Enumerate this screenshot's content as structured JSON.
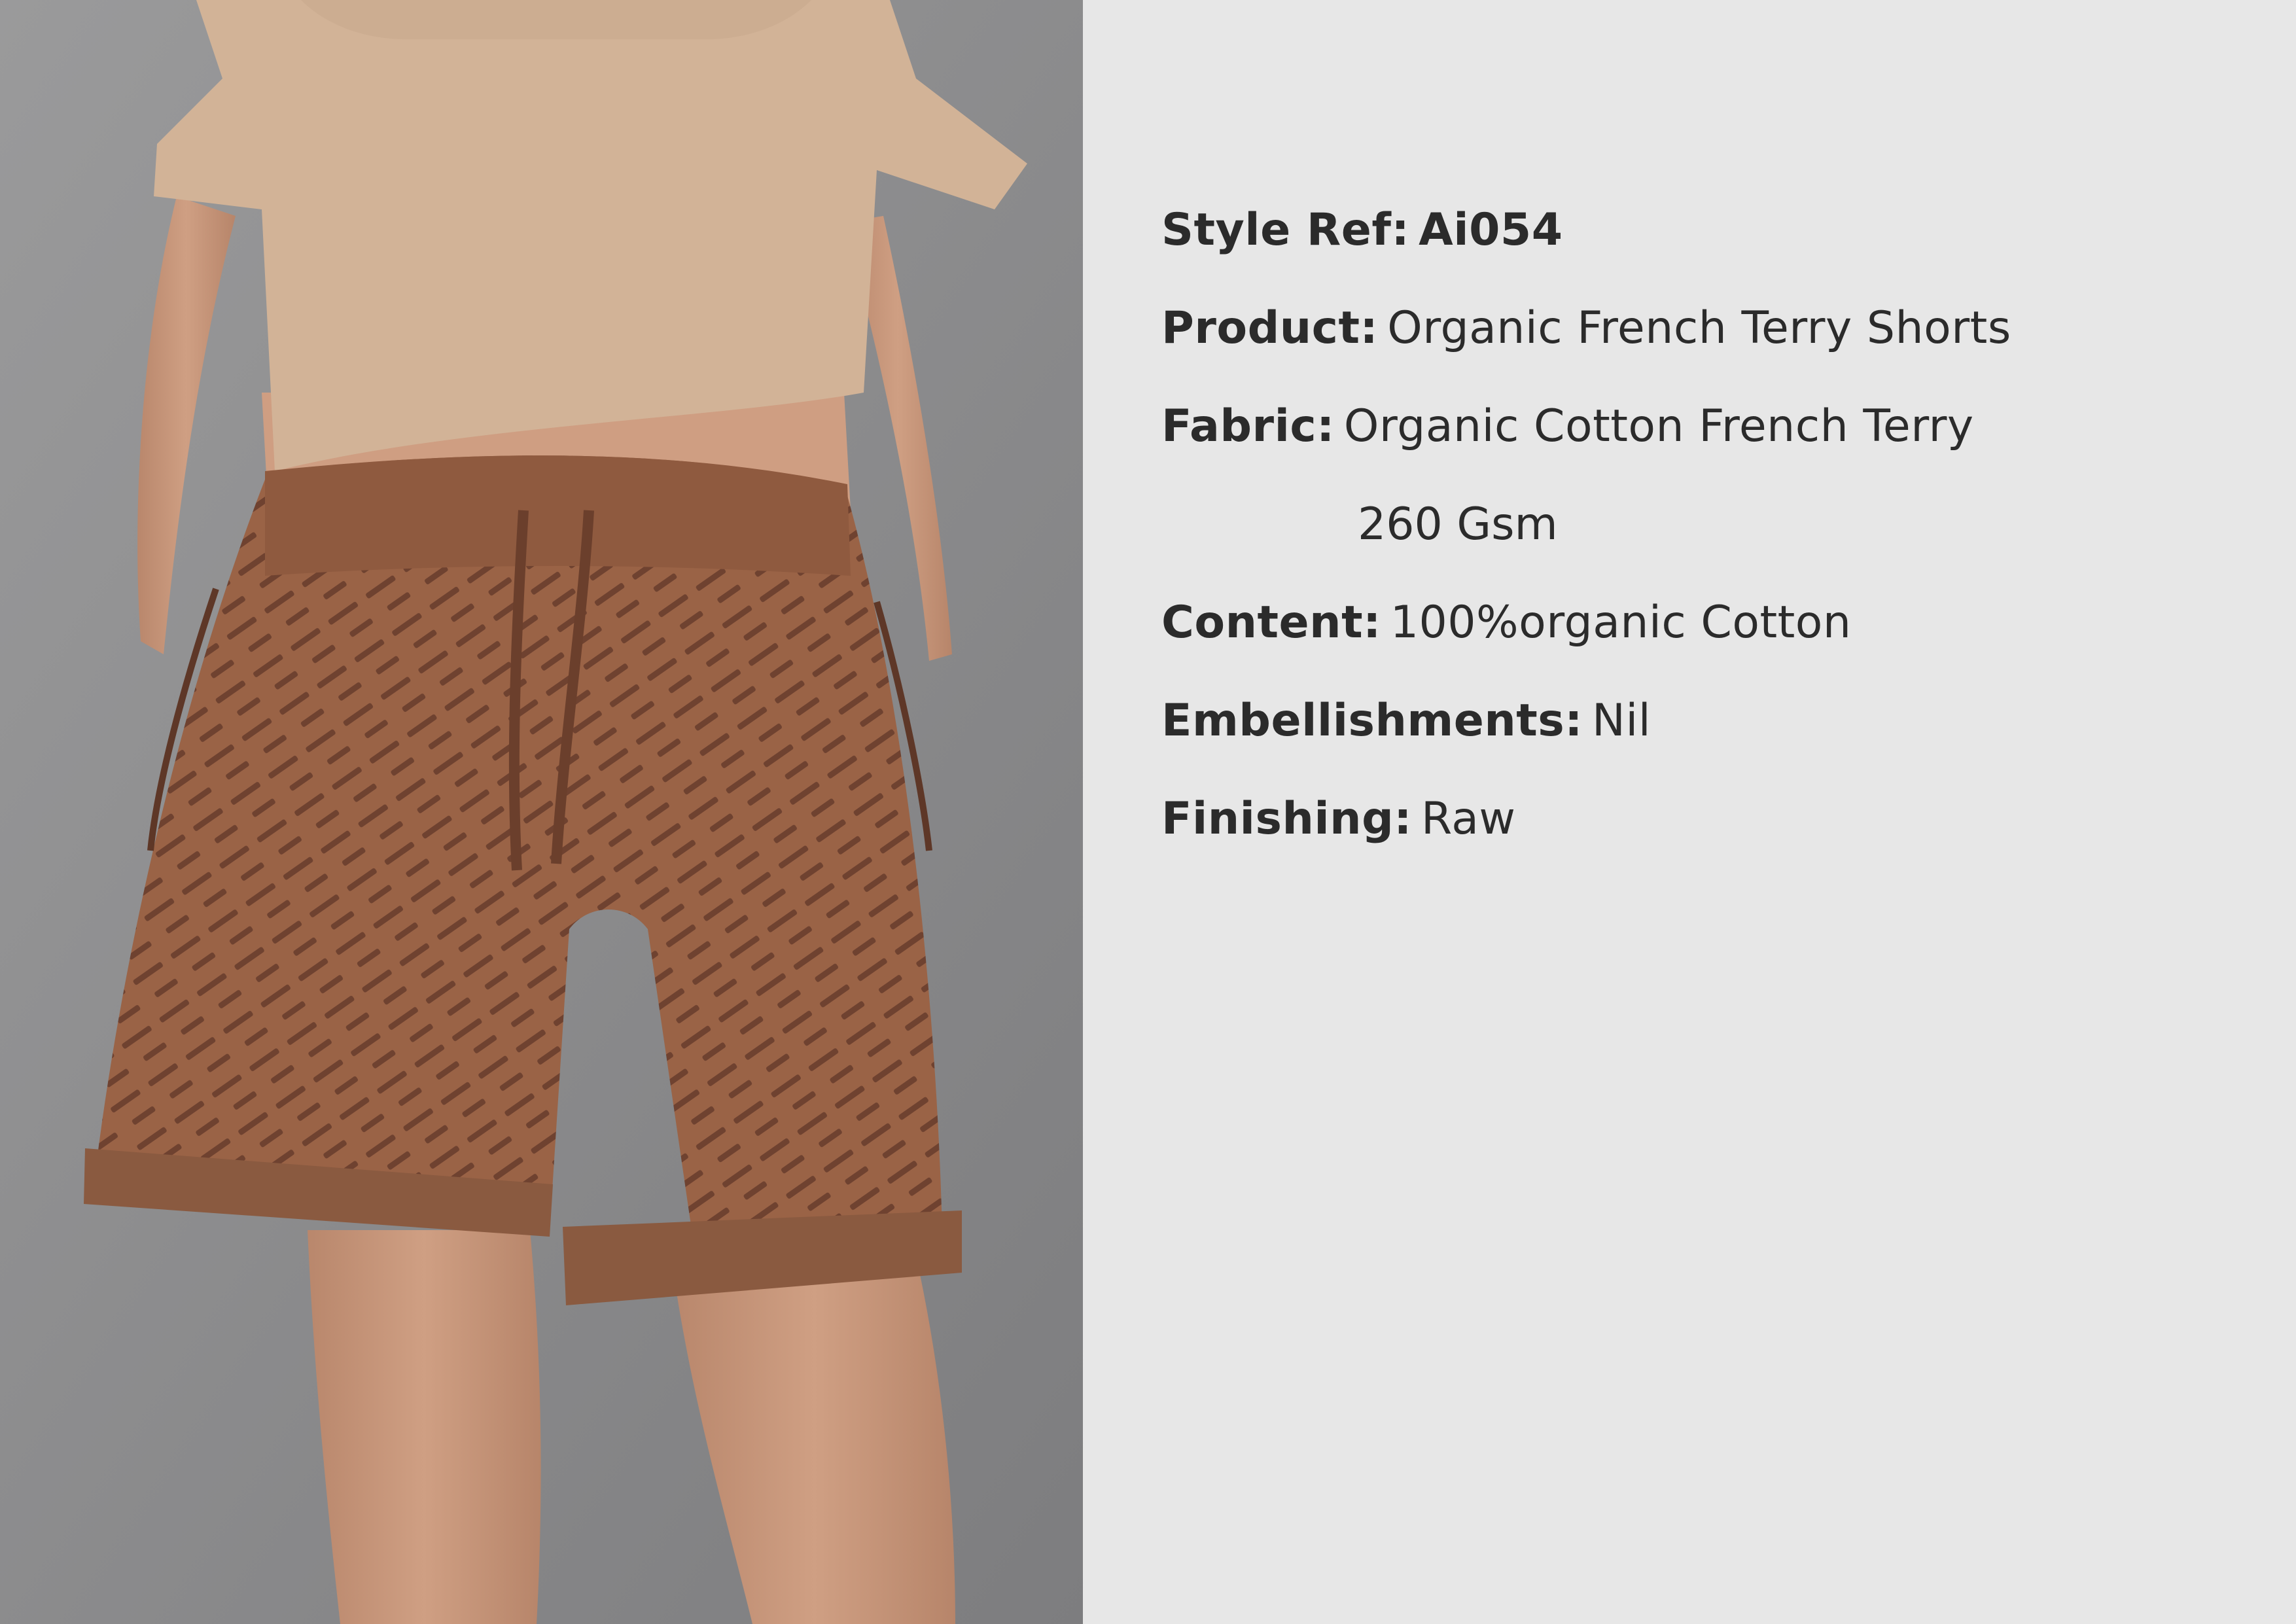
{
  "specs": {
    "style_ref": {
      "label": "Style Ref:",
      "value": "Ai054"
    },
    "product": {
      "label": "Product:",
      "value": "Organic French Terry Shorts"
    },
    "fabric": {
      "label": "Fabric:",
      "value": "Organic Cotton French Terry",
      "value_cont": "260 Gsm"
    },
    "content": {
      "label": "Content:",
      "value": "100%organic Cotton"
    },
    "embellishments": {
      "label": "Embellishments:",
      "value": "Nil"
    },
    "finishing": {
      "label": "Finishing:",
      "value": "Raw"
    }
  },
  "colors": {
    "spec_background": "#e7e7e7",
    "photo_background": "#8d8d8e",
    "top_garment": "#d2b397",
    "shorts": "#9a6346",
    "skin": "#c69579",
    "text": "#2b2b2b"
  }
}
